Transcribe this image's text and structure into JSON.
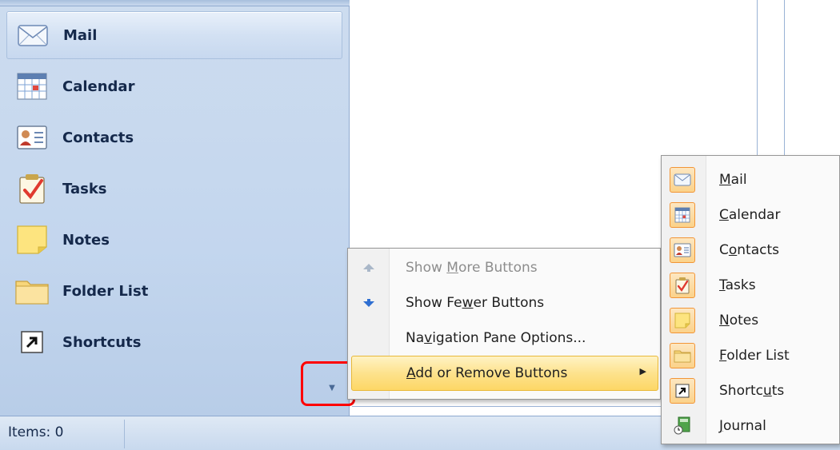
{
  "nav_pane": {
    "items": [
      {
        "label": "Mail",
        "icon": "mail-icon",
        "selected": true
      },
      {
        "label": "Calendar",
        "icon": "calendar-icon"
      },
      {
        "label": "Contacts",
        "icon": "contacts-icon"
      },
      {
        "label": "Tasks",
        "icon": "tasks-icon"
      },
      {
        "label": "Notes",
        "icon": "notes-icon"
      },
      {
        "label": "Folder List",
        "icon": "folder-icon"
      },
      {
        "label": "Shortcuts",
        "icon": "shortcut-icon"
      }
    ],
    "configure_icon": "chevron-down-icon"
  },
  "status_bar": {
    "items_text": "Items: 0"
  },
  "context_menu": {
    "items": [
      {
        "pre": "Show ",
        "key": "M",
        "post": "ore Buttons",
        "icon": "arrow-up-icon",
        "disabled": true
      },
      {
        "pre": "Show Fe",
        "key": "w",
        "post": "er Buttons",
        "icon": "arrow-down-icon"
      },
      {
        "pre": "Na",
        "key": "v",
        "post": "igation Pane Options...",
        "icon": ""
      },
      {
        "pre": "",
        "key": "A",
        "post": "dd or Remove Buttons",
        "icon": "",
        "active": true,
        "has_submenu": true
      }
    ]
  },
  "submenu": {
    "items": [
      {
        "pre": "",
        "key": "M",
        "post": "ail",
        "checked": true
      },
      {
        "pre": "",
        "key": "C",
        "post": "alendar",
        "checked": true
      },
      {
        "pre": "C",
        "key": "o",
        "post": "ntacts",
        "checked": true
      },
      {
        "pre": "",
        "key": "T",
        "post": "asks",
        "checked": true
      },
      {
        "pre": "",
        "key": "N",
        "post": "otes",
        "checked": true
      },
      {
        "pre": "",
        "key": "F",
        "post": "older List",
        "checked": true
      },
      {
        "pre": "Shortc",
        "key": "u",
        "post": "ts",
        "checked": true
      },
      {
        "pre": "",
        "key": "J",
        "post": "ournal",
        "checked": false
      }
    ]
  },
  "colors": {
    "nav_bg": "#c3d6ee",
    "menu_highlight": "#fde28d",
    "check_border": "#f29536",
    "callout": "#ff0000"
  }
}
